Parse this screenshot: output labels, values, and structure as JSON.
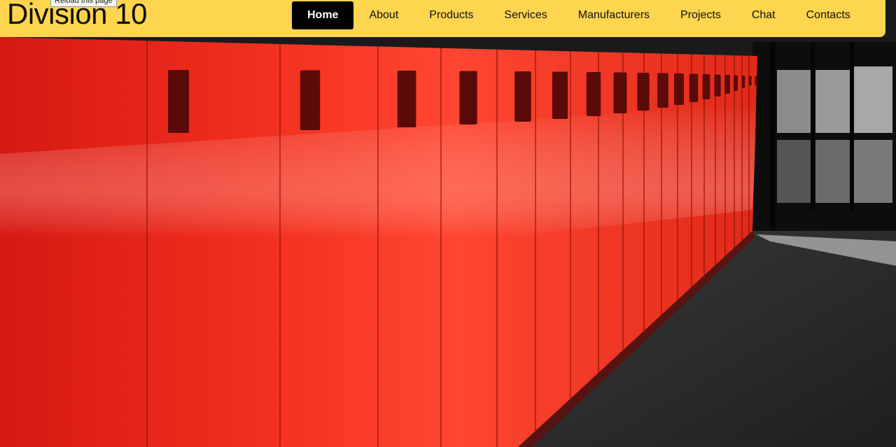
{
  "tooltip": "Reload this page",
  "brand": "Division 10",
  "nav": {
    "items": [
      {
        "label": "Home",
        "active": true
      },
      {
        "label": "About"
      },
      {
        "label": "Products"
      },
      {
        "label": "Services"
      },
      {
        "label": "Manufacturers"
      },
      {
        "label": "Projects"
      },
      {
        "label": "Chat"
      },
      {
        "label": "Contacts"
      }
    ]
  },
  "colors": {
    "header": "#fdd54f",
    "nav_active_bg": "#000000",
    "locker_red": "#e8241c",
    "floor": "#2b2b2b"
  }
}
